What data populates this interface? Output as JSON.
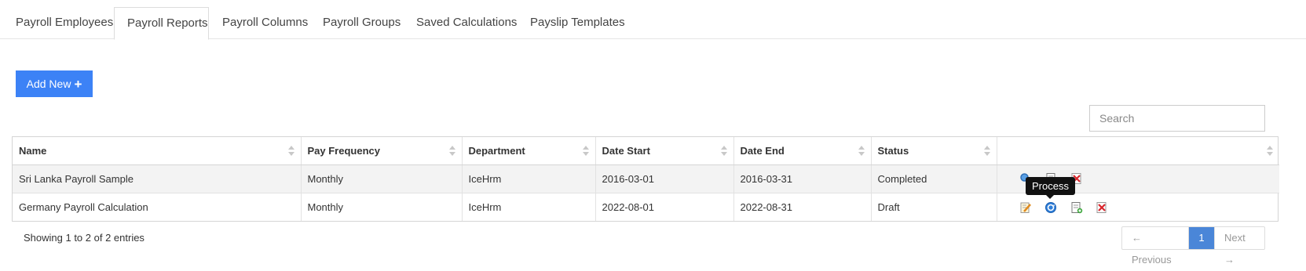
{
  "tabs": [
    {
      "label": "Payroll Employees",
      "active": false
    },
    {
      "label": "Payroll Reports",
      "active": true
    },
    {
      "label": "Payroll Columns",
      "active": false
    },
    {
      "label": "Payroll Groups",
      "active": false
    },
    {
      "label": "Saved Calculations",
      "active": false
    },
    {
      "label": "Payslip Templates",
      "active": false
    }
  ],
  "toolbar": {
    "add_new_label": "Add New",
    "add_new_icon": "plus-icon"
  },
  "search": {
    "placeholder": "Search",
    "value": ""
  },
  "table": {
    "columns": [
      "Name",
      "Pay Frequency",
      "Department",
      "Date Start",
      "Date End",
      "Status",
      ""
    ],
    "rows": [
      {
        "name": "Sri Lanka Payroll Sample",
        "pay_frequency": "Monthly",
        "department": "IceHrm",
        "date_start": "2016-03-01",
        "date_end": "2016-03-31",
        "status": "Completed",
        "actions": [
          "view-icon",
          "copy-icon",
          "delete-icon"
        ]
      },
      {
        "name": "Germany Payroll Calculation",
        "pay_frequency": "Monthly",
        "department": "IceHrm",
        "date_start": "2022-08-01",
        "date_end": "2022-08-31",
        "status": "Draft",
        "actions": [
          "edit-icon",
          "process-icon",
          "copy-icon",
          "delete-icon"
        ]
      }
    ]
  },
  "tooltip": {
    "text": "Process"
  },
  "footer": {
    "info": "Showing 1 to 2 of 2 entries",
    "pagination": {
      "previous": "← Previous",
      "current": "1",
      "next": "Next →"
    }
  },
  "colors": {
    "primary": "#3c82f6",
    "page_active": "#4a86d8",
    "delete": "#d9262c"
  }
}
